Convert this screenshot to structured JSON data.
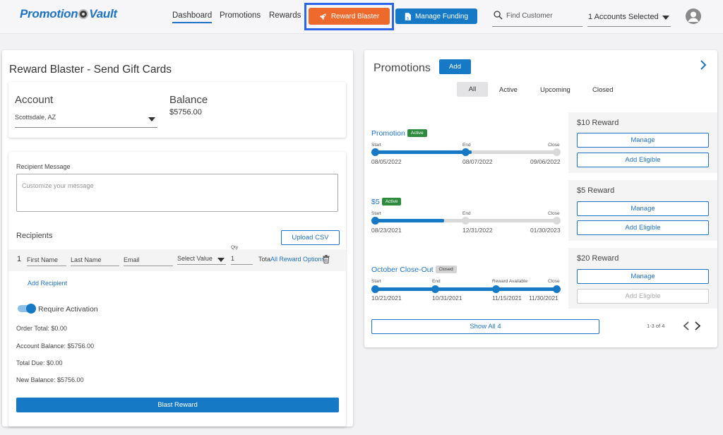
{
  "header": {
    "logo_left": "Promotion",
    "logo_right": "Vault",
    "nav": [
      "Dashboard",
      "Promotions",
      "Rewards"
    ],
    "reward_blaster": "Reward Blaster",
    "manage_funding": "Manage Funding",
    "search_placeholder": "Find Customer",
    "accounts_selected": "1 Accounts Selected"
  },
  "colors": {
    "primary": "#1679c6",
    "orange": "#ee6a2c",
    "active_badge": "#2e8b3e",
    "closed_badge": "#d4d4d4"
  },
  "left": {
    "title": "Reward Blaster - Send Gift Cards",
    "account_label": "Account",
    "account_value": "Scottsdale, AZ",
    "balance_label": "Balance",
    "balance_value": "$5756.00",
    "message_label": "Recipient Message",
    "message_placeholder": "Customize your message",
    "recipients_label": "Recipients",
    "upload_csv": "Upload CSV",
    "row_number": "1",
    "first_name": "First Name",
    "last_name": "Last Name",
    "email": "Email",
    "select_value": "Select Value",
    "qty_label": "Qty",
    "qty_value": "1",
    "total_label": "Total",
    "all_reward_options": "All Reward Options",
    "add_recipient": "Add Recipient",
    "require_activation": "Require Activation",
    "require_activation_on": true,
    "order_total": "Order Total: $0.00",
    "account_balance": "Account Balance: $5756.00",
    "total_due": "Total Due: $0.00",
    "new_balance": "New Balance: $5756.00",
    "blast_reward": "Blast Reward"
  },
  "right": {
    "title": "Promotions",
    "add": "Add",
    "tabs": [
      "All",
      "Active",
      "Upcoming",
      "Closed"
    ],
    "selected_tab": "All",
    "promotions": [
      {
        "name": "Promotion",
        "status": "Active",
        "labels": [
          "Start",
          "End",
          "Close"
        ],
        "dates": [
          "08/05/2022",
          "08/07/2022",
          "09/06/2022"
        ],
        "progress": 0.53,
        "reward": "$10 Reward",
        "manage": "Manage",
        "add_eligible": "Add Eligible"
      },
      {
        "name": "$5",
        "status": "Active",
        "labels": [
          "Start",
          "End",
          "Close"
        ],
        "dates": [
          "08/23/2021",
          "12/31/2022",
          "01/30/2023"
        ],
        "progress": 0.38,
        "reward": "$5 Reward",
        "manage": "Manage",
        "add_eligible": "Add Eligible"
      },
      {
        "name": "October Close-Out",
        "status": "Closed",
        "labels": [
          "Start",
          "End",
          "Reward Available",
          "Close"
        ],
        "dates": [
          "10/21/2021",
          "10/31/2021",
          "11/15/2021",
          "11/30/2021"
        ],
        "progress": 1.0,
        "reward": "$20 Reward",
        "manage": "Manage",
        "add_eligible": "Add Eligible"
      }
    ],
    "show_all": "Show All 4",
    "pagination": "1-3 of 4"
  }
}
